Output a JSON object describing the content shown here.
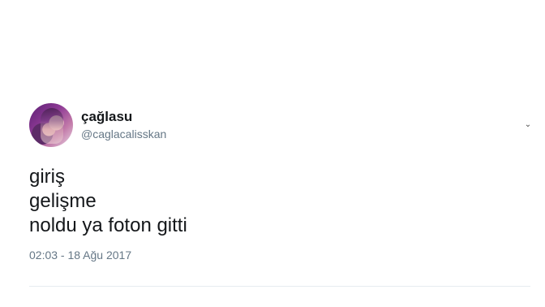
{
  "tweet": {
    "display_name": "çağlasu",
    "handle": "@caglacalisskan",
    "lines": [
      "giriş",
      "gelişme",
      "noldu ya foton gitti"
    ],
    "timestamp": "02:03 - 18 Ağu 2017"
  },
  "icons": {
    "avatar": "profile-photo",
    "menu": "chevron-down-icon"
  }
}
